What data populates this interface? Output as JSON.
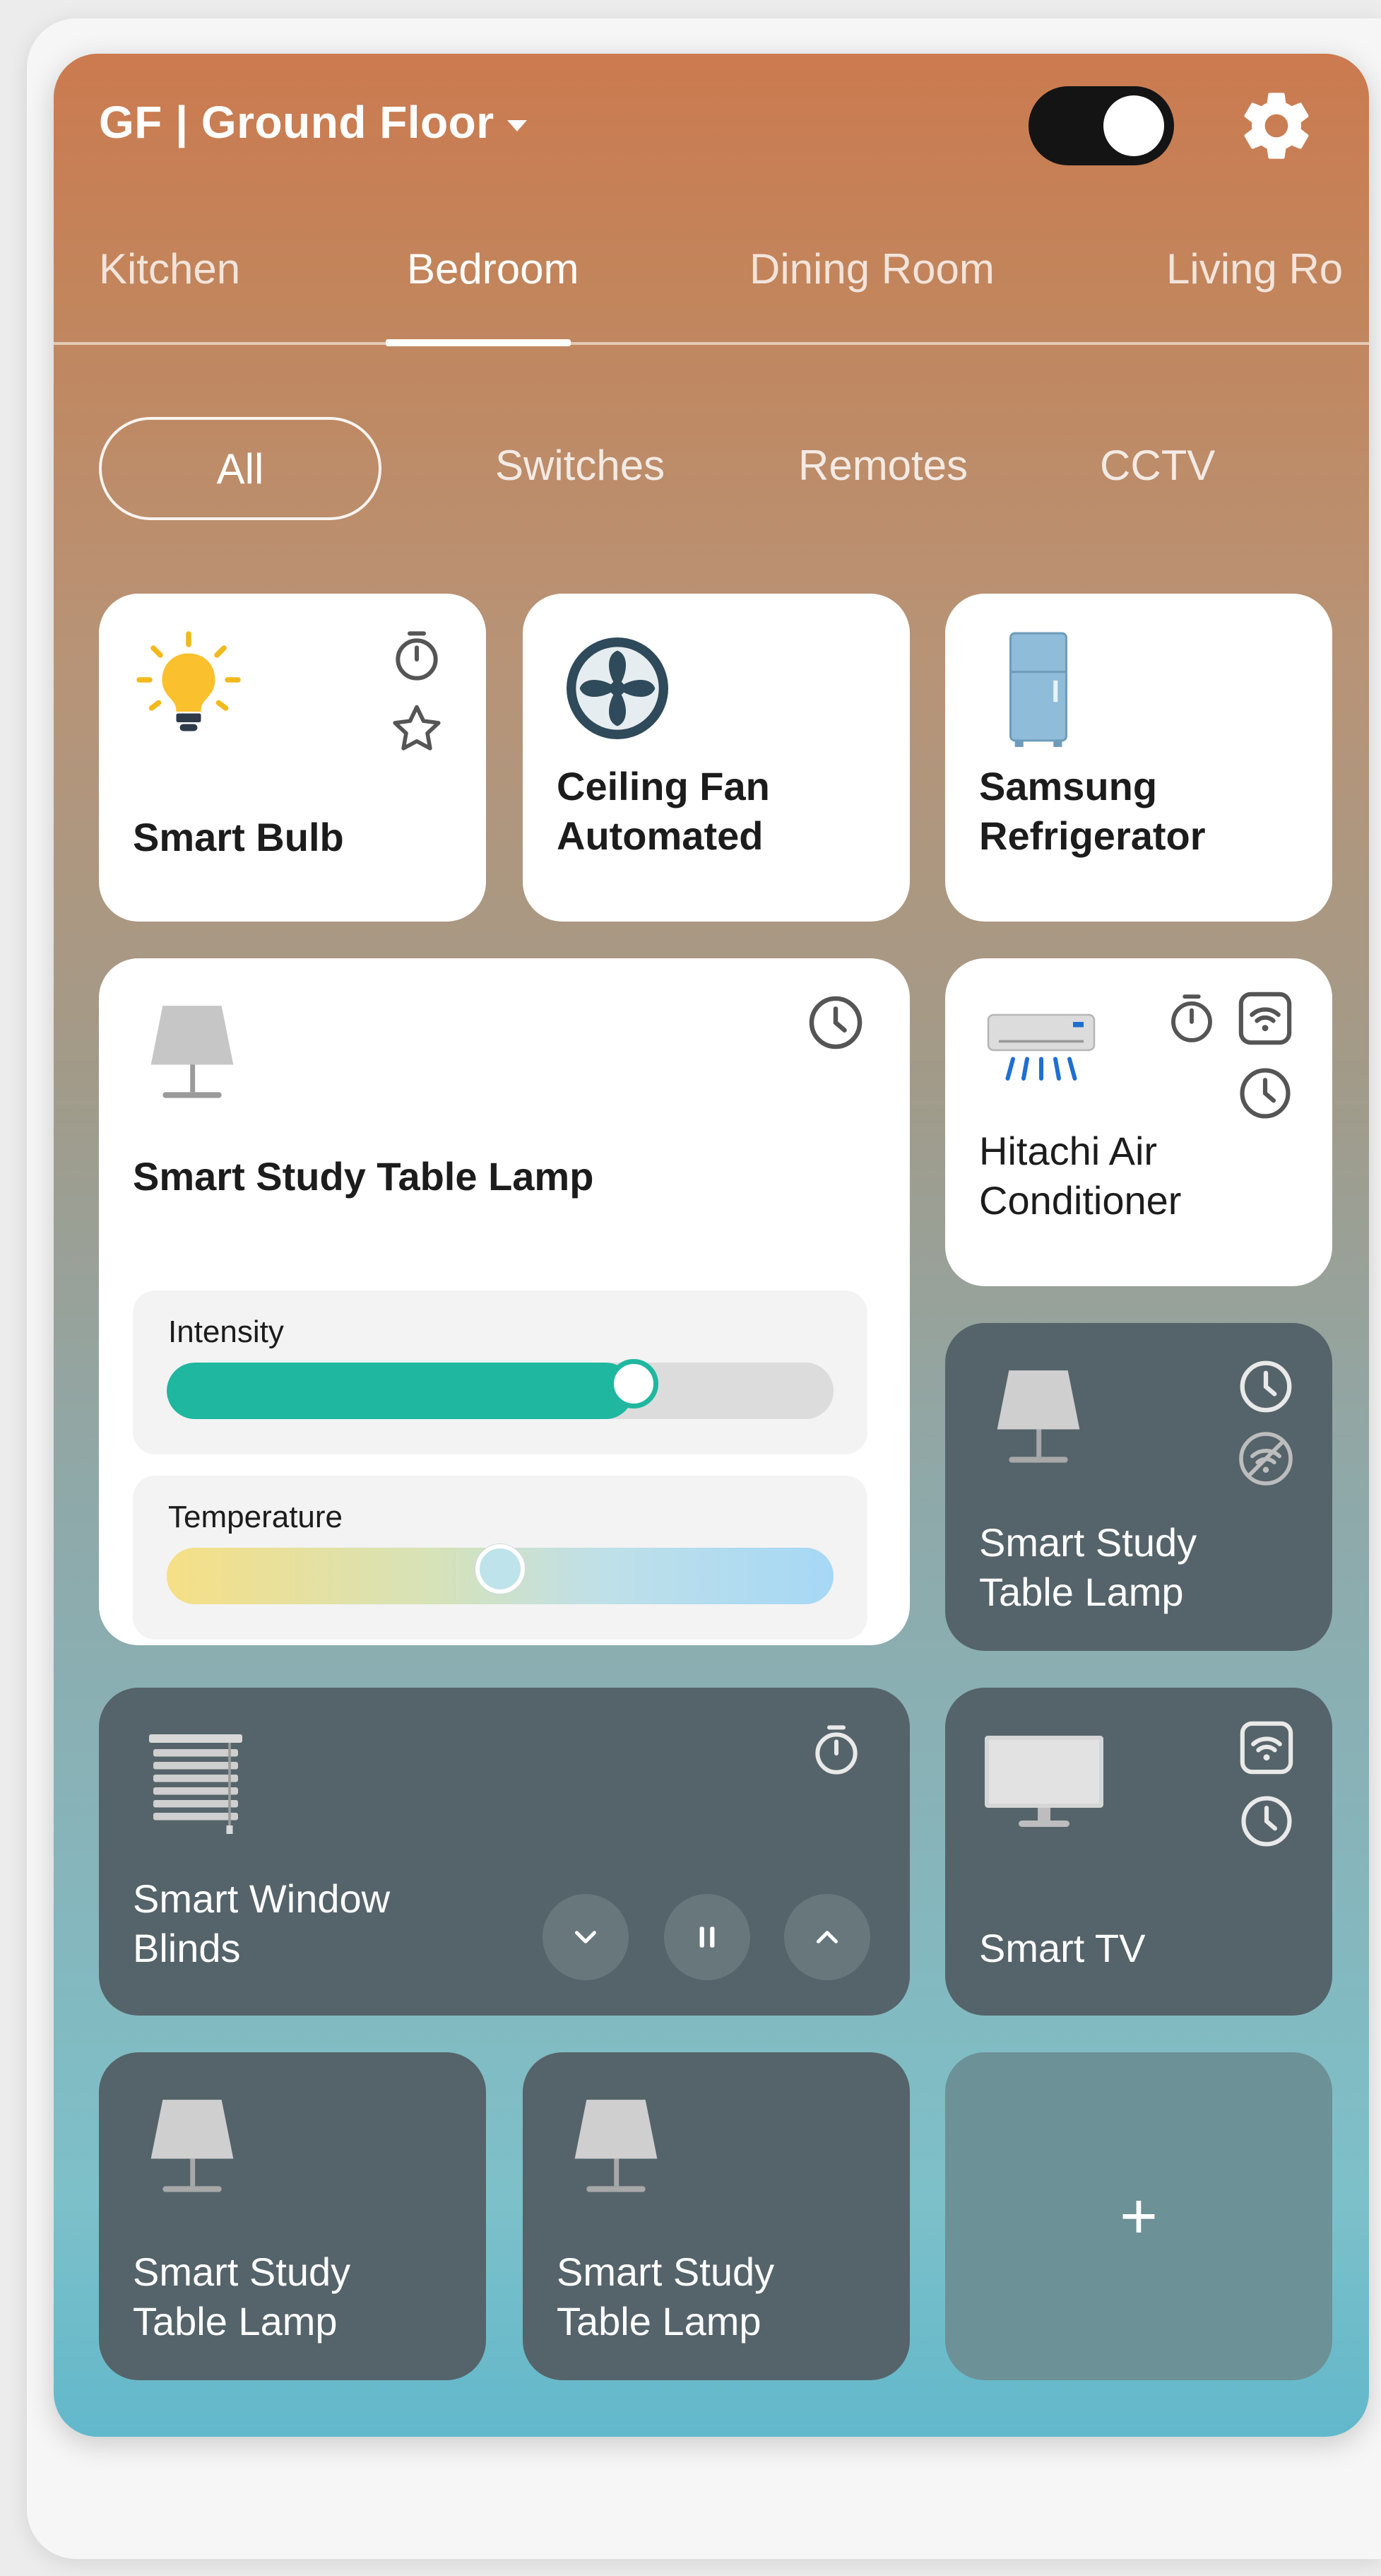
{
  "header": {
    "floor_title": "GF | Ground Floor",
    "toggle_state": "on"
  },
  "room_tabs": [
    {
      "label": "Kitchen",
      "active": false
    },
    {
      "label": "Bedroom",
      "active": true
    },
    {
      "label": "Dining Room",
      "active": false
    },
    {
      "label": "Living Ro",
      "active": false
    }
  ],
  "filters": [
    {
      "label": "All",
      "active": true
    },
    {
      "label": "Switches",
      "active": false
    },
    {
      "label": "Remotes",
      "active": false
    },
    {
      "label": "CCTV",
      "active": false
    }
  ],
  "devices": {
    "smart_bulb": {
      "name": "Smart Bulb",
      "icon": "lightbulb-icon"
    },
    "ceiling_fan": {
      "name_line1": "Ceiling Fan",
      "name_line2": "Automated",
      "icon": "fan-icon"
    },
    "refrigerator": {
      "name_line1": "Samsung",
      "name_line2": "Refrigerator",
      "icon": "refrigerator-icon"
    },
    "study_lamp_main": {
      "name": "Smart Study Table Lamp",
      "intensity_label": "Intensity",
      "intensity_value": 0.7,
      "temperature_label": "Temperature",
      "temperature_value": 0.5
    },
    "air_conditioner": {
      "name_line1": "Hitachi Air",
      "name_line2": "Conditioner",
      "icon": "air-conditioner-icon"
    },
    "study_lamp_2": {
      "name_line1": "Smart Study",
      "name_line2": "Table Lamp"
    },
    "window_blinds": {
      "name_line1": "Smart Window",
      "name_line2": "Blinds"
    },
    "smart_tv": {
      "name": "Smart TV"
    },
    "study_lamp_3": {
      "name_line1": "Smart Study",
      "name_line2": "Table Lamp"
    },
    "study_lamp_4": {
      "name_line1": "Smart Study",
      "name_line2": "Table Lamp"
    },
    "add_device": {
      "label": "+"
    }
  },
  "colors": {
    "accent_teal": "#1fb7a0",
    "card_dark": "#55646a",
    "header_top": "#cc7a4f"
  }
}
